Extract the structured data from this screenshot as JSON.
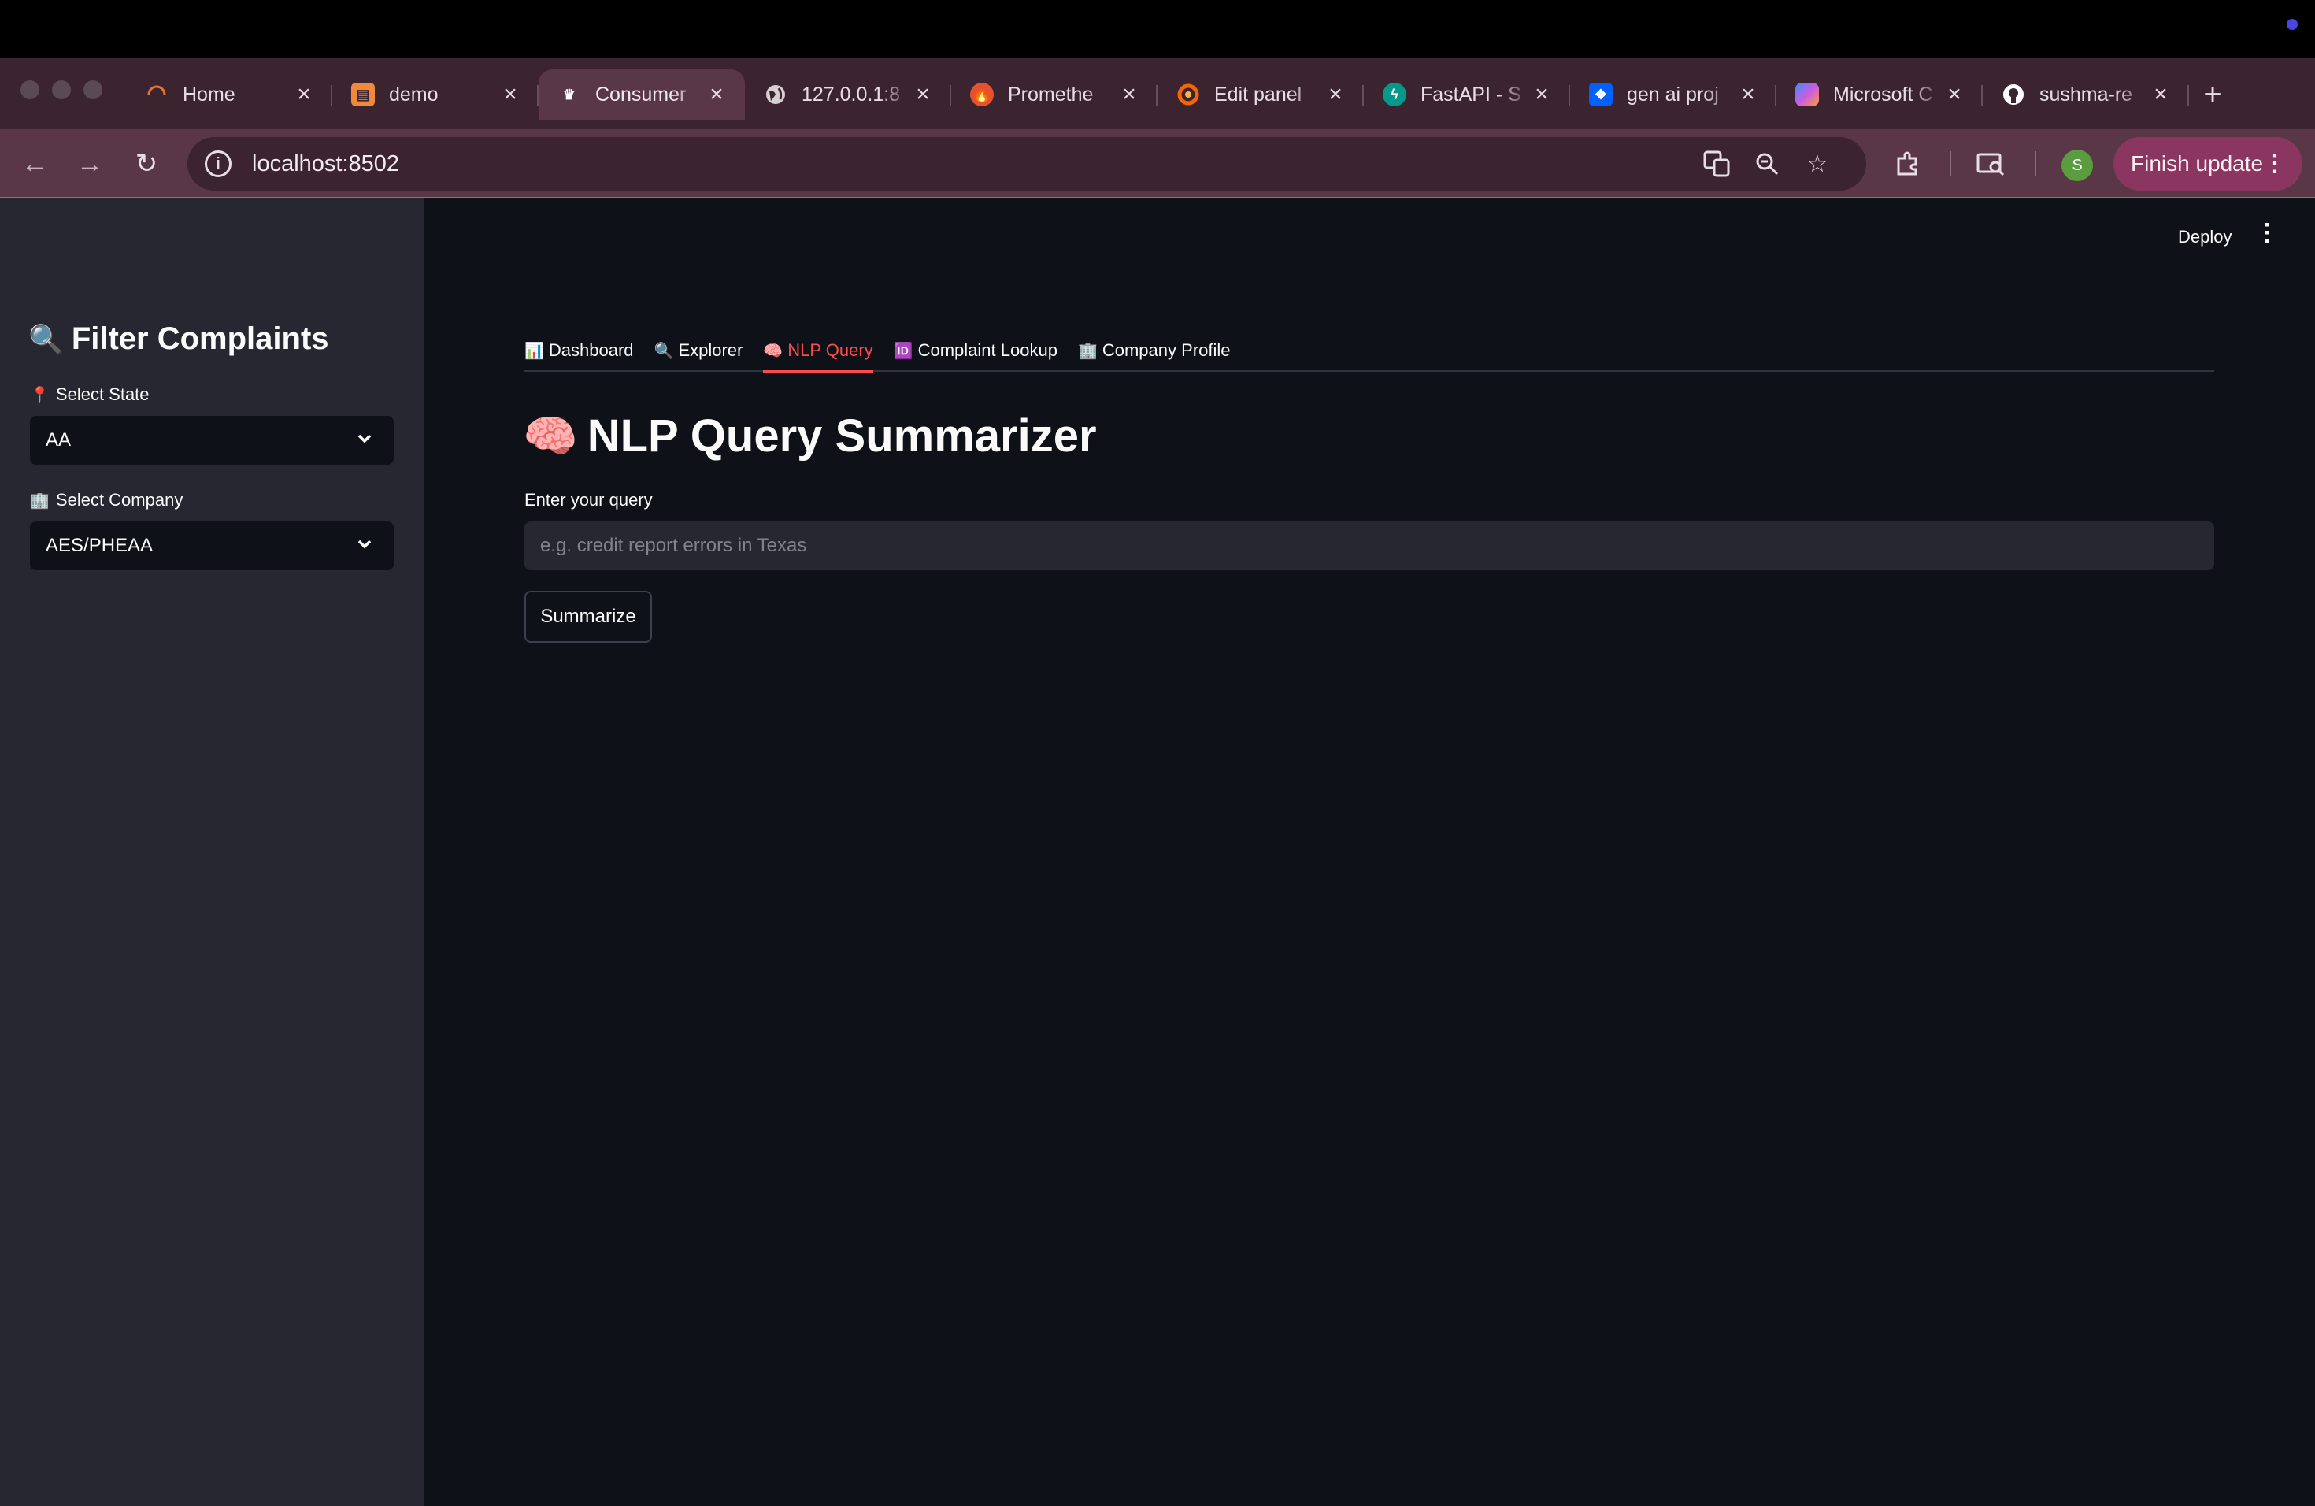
{
  "browser": {
    "tabs": [
      {
        "label": "Home",
        "icon": "loading-spinner-icon",
        "color": "#e8772e"
      },
      {
        "label": "demo",
        "icon": "notebook-icon",
        "color": "#f08a3a"
      },
      {
        "label": "Consumer",
        "icon": "streamlit-crown-icon",
        "color": "#ffffff",
        "active": true
      },
      {
        "label": "127.0.0.1:8",
        "icon": "globe-icon",
        "color": "#d6d0d3"
      },
      {
        "label": "Promethe",
        "icon": "prometheus-icon",
        "color": "#e6522c"
      },
      {
        "label": "Edit panel",
        "icon": "grafana-icon",
        "color": "#f46800"
      },
      {
        "label": "FastAPI - S",
        "icon": "fastapi-icon",
        "color": "#05998b"
      },
      {
        "label": "gen ai proj",
        "icon": "dropbox-icon",
        "color": "#0061fe"
      },
      {
        "label": "Microsoft C",
        "icon": "copilot-icon",
        "color": "#9b5de5"
      },
      {
        "label": "sushma-re",
        "icon": "github-icon",
        "color": "#ffffff"
      }
    ],
    "url": "localhost:8502",
    "finish_update": "Finish update",
    "avatar_letter": "S"
  },
  "app": {
    "deploy": "Deploy",
    "sidebar": {
      "title_icon": "🔍",
      "title": "Filter Complaints",
      "state_icon": "📍",
      "state_label": "Select State",
      "state_value": "AA",
      "company_icon": "🏢",
      "company_label": "Select Company",
      "company_value": "AES/PHEAA"
    },
    "tabs": [
      {
        "icon": "📊",
        "label": "Dashboard"
      },
      {
        "icon": "🔍",
        "label": "Explorer"
      },
      {
        "icon": "🧠",
        "label": "NLP Query",
        "active": true
      },
      {
        "icon": "🆔",
        "label": "Complaint Lookup"
      },
      {
        "icon": "🏢",
        "label": "Company Profile"
      }
    ],
    "page": {
      "title_icon": "🧠",
      "title": "NLP Query Summarizer",
      "query_label": "Enter your query",
      "query_placeholder": "e.g. credit report errors in Texas",
      "query_value": "",
      "button": "Summarize"
    },
    "colors": {
      "accent": "#ff4b4b",
      "sidebar_bg": "#262730",
      "main_bg": "#0e1117"
    }
  }
}
